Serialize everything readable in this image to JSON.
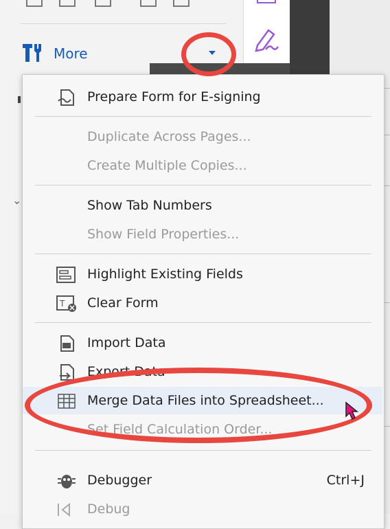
{
  "more": {
    "label": "More"
  },
  "colors": {
    "accent": "#1a5bb2",
    "annotation": "#e8473f",
    "esign_icon": "#9b59d0"
  },
  "menu": {
    "items": [
      {
        "label": "Prepare Form for E-signing",
        "icon": "esign-prepare-icon",
        "disabled": false
      },
      {
        "label": "Duplicate Across Pages...",
        "icon": "",
        "disabled": true
      },
      {
        "label": "Create Multiple Copies...",
        "icon": "",
        "disabled": true
      },
      {
        "label": "Show Tab Numbers",
        "icon": "",
        "disabled": false
      },
      {
        "label": "Show Field Properties...",
        "icon": "",
        "disabled": true
      },
      {
        "label": "Highlight Existing Fields",
        "icon": "highlight-fields-icon",
        "disabled": false
      },
      {
        "label": "Clear Form",
        "icon": "clear-form-icon",
        "disabled": false
      },
      {
        "label": "Import Data",
        "icon": "import-data-icon",
        "disabled": false
      },
      {
        "label": "Export Data",
        "icon": "export-data-icon",
        "disabled": false
      },
      {
        "label": "Merge Data Files into Spreadsheet...",
        "icon": "spreadsheet-icon",
        "disabled": false
      },
      {
        "label": "Set Field Calculation Order...",
        "icon": "",
        "disabled": true
      },
      {
        "label": "Debugger",
        "icon": "debugger-icon",
        "disabled": false,
        "shortcut": "Ctrl+J"
      },
      {
        "label": "Debug",
        "icon": "debug-icon",
        "disabled": true
      }
    ]
  }
}
